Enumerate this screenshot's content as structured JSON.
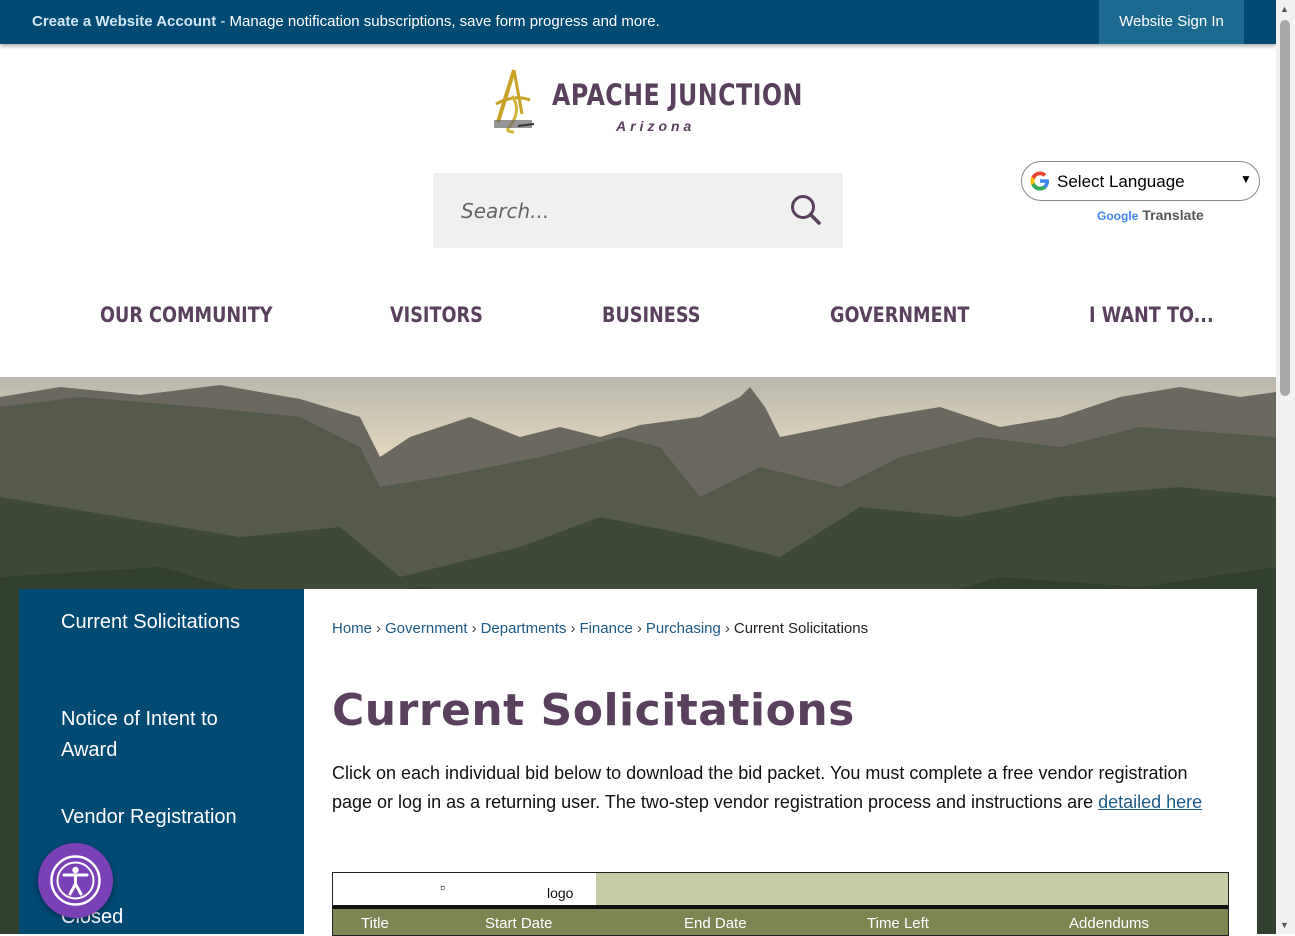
{
  "topbar": {
    "create_account": "Create a Website Account",
    "message": " - Manage notification subscriptions, save form progress and more.",
    "sign_in": "Website Sign In"
  },
  "logo": {
    "title": "APACHE JUNCTION",
    "subtitle": "Arizona"
  },
  "search": {
    "placeholder": "Search..."
  },
  "translate": {
    "select_label": "Select Language",
    "powered_by": "Google",
    "translate_label": "Translate"
  },
  "nav": [
    "OUR COMMUNITY",
    "VISITORS",
    "BUSINESS",
    "GOVERNMENT",
    "I WANT TO..."
  ],
  "sidebar": {
    "items": [
      "Current Solicitations",
      "Notice of Intent to Award",
      "Vendor Registration",
      "Closed"
    ]
  },
  "breadcrumb": {
    "links": [
      "Home",
      "Government",
      "Departments",
      "Finance",
      "Purchasing"
    ],
    "current": "Current Solicitations"
  },
  "page": {
    "title": "Current Solicitations",
    "intro": "Click on each individual bid below to download the bid packet. You must complete a free vendor registration page or log in as a returning user. The two-step vendor registration process and instructions are ",
    "intro_link": "detailed here"
  },
  "bid_table": {
    "logo_alt": "logo",
    "columns": [
      "Title",
      "Start Date",
      "End Date",
      "Time Left",
      "Addendums"
    ]
  },
  "colors": {
    "brand_blue": "#004a73",
    "brand_purple": "#59405c",
    "table_header": "#7e8553",
    "table_band": "#c6cca3"
  },
  "icons": [
    "search-icon",
    "google-g-icon",
    "chevron-down-icon",
    "accessibility-icon"
  ]
}
